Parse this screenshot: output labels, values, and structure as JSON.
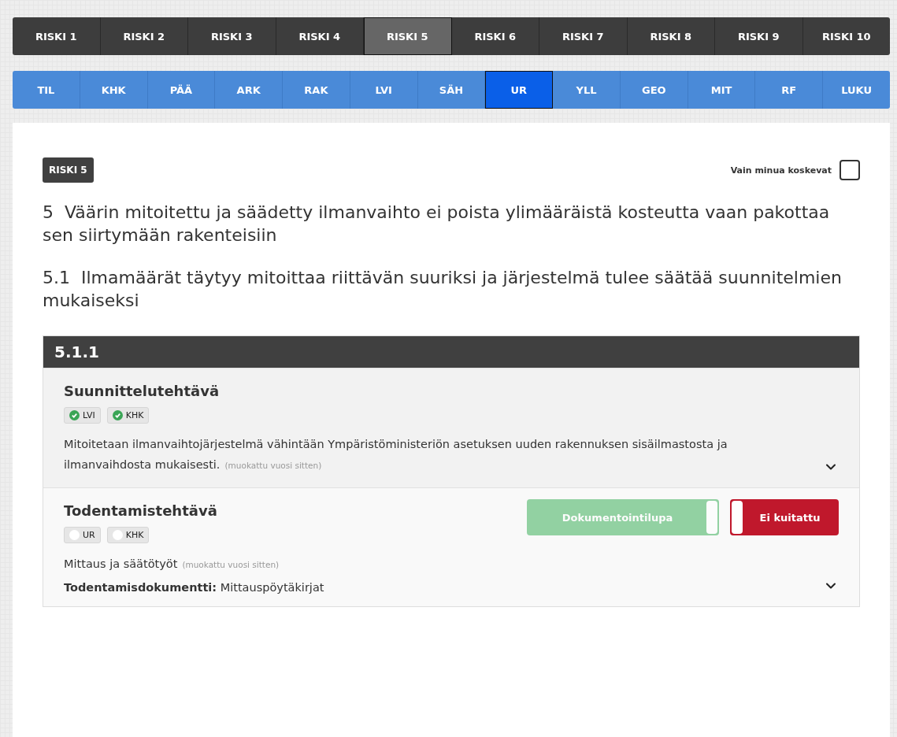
{
  "risk_tabs": [
    {
      "label": "RISKI 1",
      "selected": false
    },
    {
      "label": "RISKI 2",
      "selected": false
    },
    {
      "label": "RISKI 3",
      "selected": false
    },
    {
      "label": "RISKI 4",
      "selected": false
    },
    {
      "label": "RISKI 5",
      "selected": true
    },
    {
      "label": "RISKI 6",
      "selected": false
    },
    {
      "label": "RISKI 7",
      "selected": false
    },
    {
      "label": "RISKI 8",
      "selected": false
    },
    {
      "label": "RISKI 9",
      "selected": false
    },
    {
      "label": "RISKI 10",
      "selected": false
    }
  ],
  "discipline_tabs": [
    {
      "label": "TIL",
      "selected": false
    },
    {
      "label": "KHK",
      "selected": false
    },
    {
      "label": "PÄÄ",
      "selected": false
    },
    {
      "label": "ARK",
      "selected": false
    },
    {
      "label": "RAK",
      "selected": false
    },
    {
      "label": "LVI",
      "selected": false
    },
    {
      "label": "SÄH",
      "selected": false
    },
    {
      "label": "UR",
      "selected": true
    },
    {
      "label": "YLL",
      "selected": false
    },
    {
      "label": "GEO",
      "selected": false
    },
    {
      "label": "MIT",
      "selected": false
    },
    {
      "label": "RF",
      "selected": false
    },
    {
      "label": "LUKU",
      "selected": false
    }
  ],
  "risk_badge": "RISKI 5",
  "filter": {
    "label": "Vain minua koskevat",
    "checked": false
  },
  "risk_title": "5  Väärin mitoitettu ja säädetty ilmanvaihto ei poista ylimääräistä kosteutta vaan pakottaa sen siirtymään rakenteisiin",
  "subtitle": "5.1  Ilmamäärät täytyy mitoittaa riittävän suuriksi ja järjestelmä tulee säätää suunnitelmien mukaiseksi",
  "section": {
    "number": "5.1.1",
    "tasks": [
      {
        "title": "Suunnittelutehtävä",
        "tags": [
          {
            "label": "LVI",
            "done": true
          },
          {
            "label": "KHK",
            "done": true
          }
        ],
        "description": "Mitoitetaan ilmanvaihtojärjestelmä vähintään Ympäristöministeriön asetuksen uuden rakennuksen sisäilmastosta ja ilmanvaihdosta mukaisesti.",
        "modified": "(muokattu vuosi sitten)"
      },
      {
        "title": "Todentamistehtävä",
        "tags": [
          {
            "label": "UR",
            "done": false
          },
          {
            "label": "KHK",
            "done": false
          }
        ],
        "description": "Mittaus ja säätötyöt",
        "modified": "(muokattu vuosi sitten)",
        "document_label": "Todentamisdokumentti:",
        "document_value": "Mittauspöytäkirjat",
        "toggles": [
          {
            "label": "Dokumentointilupa",
            "on": true,
            "disabled": true
          },
          {
            "label": "Ei kuitattu",
            "on": false,
            "disabled": false
          }
        ]
      }
    ]
  }
}
